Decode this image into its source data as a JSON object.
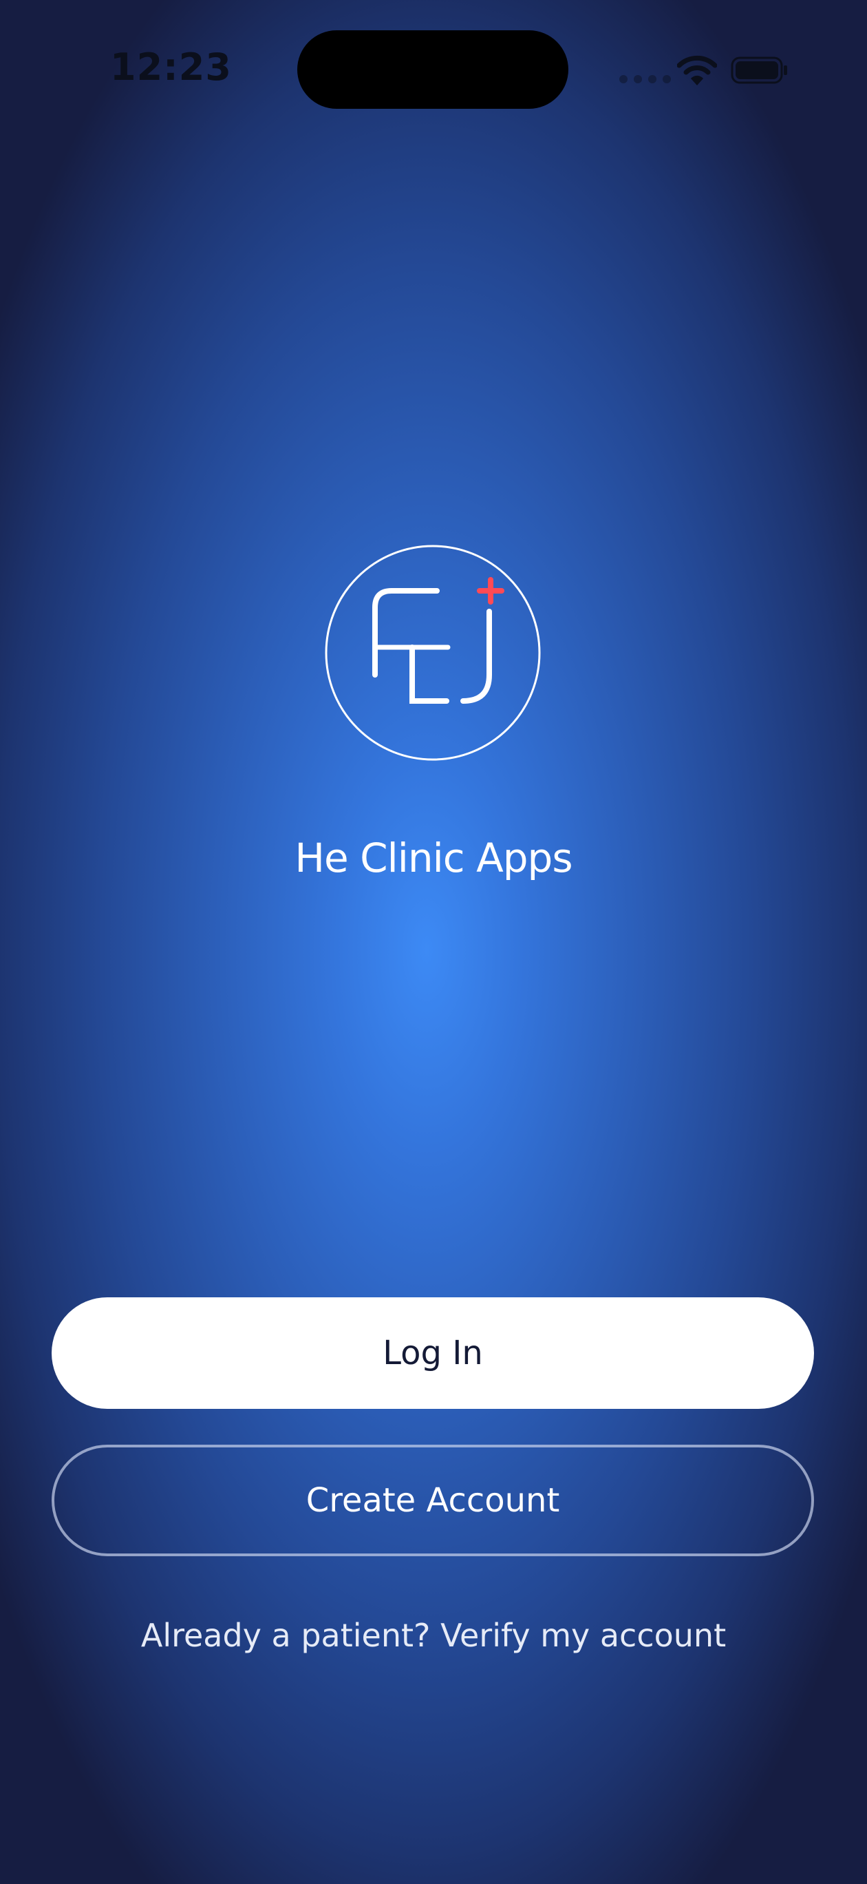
{
  "status_bar": {
    "time": "12:23"
  },
  "brand": {
    "app_name": "He Clinic Apps",
    "logo_icon": "he-clinic-logo-icon",
    "accent_color": "#ff4a55"
  },
  "actions": {
    "login_label": "Log In",
    "create_account_label": "Create Account",
    "verify_link_label": "Already a patient? Verify my account"
  },
  "icons": {
    "signal": "cellular-signal-icon",
    "wifi": "wifi-icon",
    "battery": "battery-icon"
  }
}
